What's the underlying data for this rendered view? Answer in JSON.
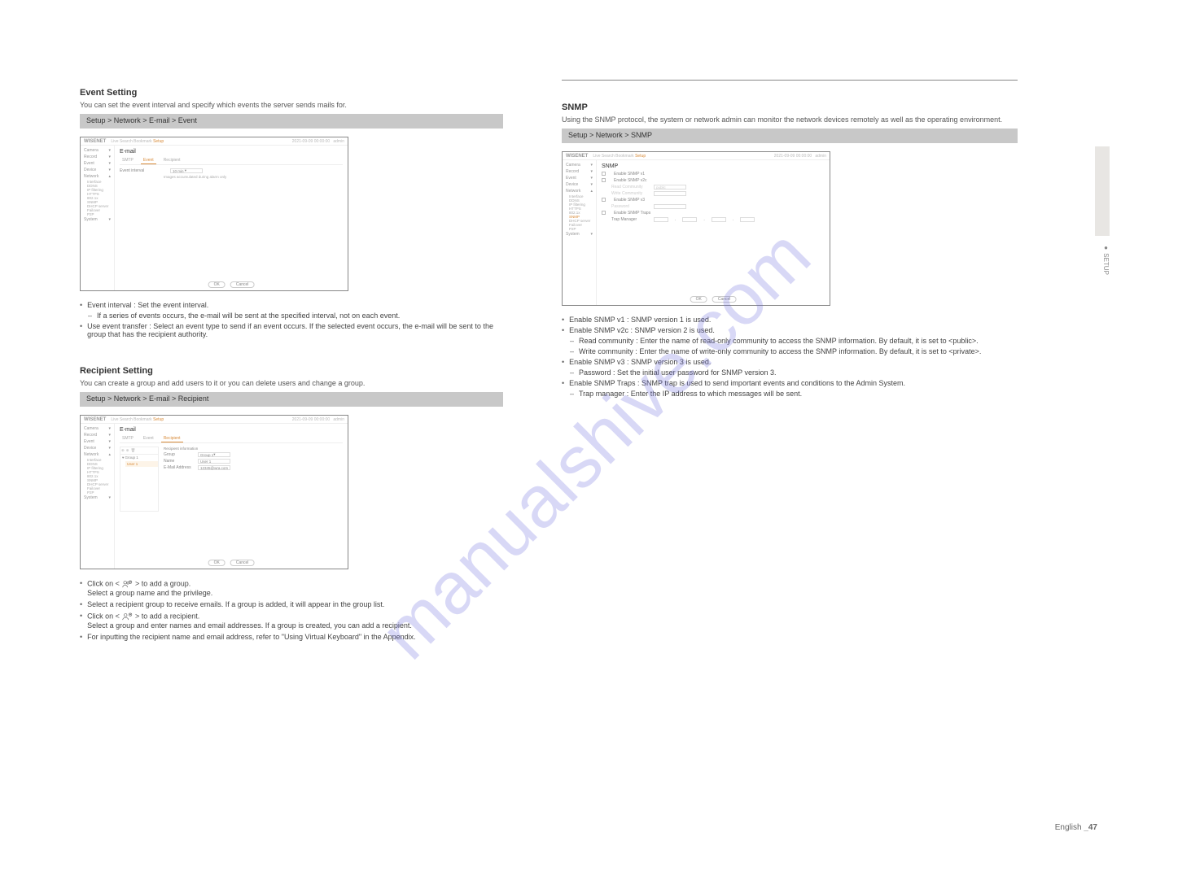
{
  "page": {
    "footer_label": "English",
    "footer_page": "_47"
  },
  "side_tab": {
    "label": "SETUP"
  },
  "watermark": "manualshive.com",
  "common_ui": {
    "logo": "WISENET",
    "topnav": {
      "live": "Live",
      "search": "Search",
      "bookmark": "Bookmark",
      "setup": "Setup"
    },
    "datetime": "2021-09-09 00:00:00",
    "user": "admin",
    "sidebar": {
      "camera": "Camera",
      "record": "Record",
      "event": "Event",
      "device": "Device",
      "network": "Network",
      "system": "System",
      "net_items": [
        "Interface",
        "DDNS",
        "IP filtering",
        "HTTPS",
        "802.1x",
        "SNMP",
        "DHCP server",
        "Failover",
        "P2P"
      ]
    },
    "buttons": {
      "ok": "OK",
      "cancel": "Cancel"
    }
  },
  "section_event": {
    "heading": "Event Setting",
    "desc": "You can set the event interval and specify which events the server sends mails for.",
    "bar": "Setup > Network > E-mail > Event",
    "screenshot": {
      "title": "E-mail",
      "tabs": {
        "smtp": "SMTP",
        "event": "Event",
        "recipient": "Recipient"
      },
      "field_label": "Event interval",
      "field_value": "10 min",
      "help": "Images accumulated during alarm only"
    },
    "bullets": [
      {
        "label": "Event interval",
        "text": ": Set the event interval."
      },
      {
        "sub": true,
        "text": "If a series of events occurs, the e-mail will be sent at the specified interval, not on each event."
      },
      {
        "label": "Use event transfer",
        "text": ": Select an event type to send if an event occurs. If the selected event occurs, the e-mail will be sent to the group that has the recipient authority."
      }
    ]
  },
  "section_recipient": {
    "heading": "Recipient Setting",
    "desc": "You can create a group and add users to it or you can delete users and change a group.",
    "bar": "Setup > Network > E-mail > Recipient",
    "screenshot": {
      "title": "E-mail",
      "tabs": {
        "smtp": "SMTP",
        "event": "Event",
        "recipient": "Recipient"
      },
      "group_toggle": "Group 1",
      "group_user": "User 1",
      "info_heading": "Recipient information",
      "field_group": "Group",
      "field_group_val": "Group 1",
      "field_name": "Name",
      "field_name_val": "User 1",
      "field_email": "E-Mail Address",
      "field_email_val": "12345@wra.com"
    },
    "bullets": [
      {
        "add_group": true,
        "text_before": "Click on <",
        "text_after": "> to add a group.",
        "text_tail": "Select a group name and the privilege."
      },
      {
        "text": "Select a recipient group to receive emails. If a group is added, it will appear in the group list."
      },
      {
        "add_recipient": true,
        "text_before": "Click on <",
        "text_after": "> to add a recipient.",
        "text_tail": "Select a group and enter names and email addresses. If a group is created, you can add a recipient."
      },
      {
        "text": "For inputting the recipient name and email address, refer to \"Using Virtual Keyboard\" in the Appendix."
      }
    ]
  },
  "section_snmp": {
    "heading": "SNMP",
    "desc": "Using the SNMP protocol, the system or network admin can monitor the network devices remotely as well as the operating environment.",
    "bar": "Setup > Network > SNMP",
    "screenshot": {
      "title": "SNMP",
      "v1": "Enable SNMP v1",
      "v2c": "Enable SNMP v2c",
      "readcomm": "Read Community",
      "readcomm_val": "public",
      "writecomm": "Write Community",
      "v3": "Enable SNMP v3",
      "password": "Password",
      "traps": "Enable SNMP Traps",
      "trapmgr": "Trap Manager"
    },
    "bullets": [
      {
        "label": "Enable SNMP v1",
        "text": ": SNMP version 1 is used."
      },
      {
        "label": "Enable SNMP v2c",
        "text": ": SNMP version 2 is used."
      },
      {
        "sub_label": "Read community",
        "text": ": Enter the name of read-only community to access the SNMP information. By default, it is set to <public>."
      },
      {
        "sub_label": "Write community",
        "text": ": Enter the name of write-only community to access the SNMP information. By default, it is set to <private>."
      },
      {
        "label": "Enable SNMP v3",
        "text": ": SNMP version 3 is used."
      },
      {
        "sub_label": "Password",
        "text": ": Set the initial user password for SNMP version 3."
      },
      {
        "label": "Enable SNMP Traps",
        "text": ": SNMP trap is used to send important events and conditions to the Admin System."
      },
      {
        "sub_label": "Trap manager",
        "text": ": Enter the IP address to which messages will be sent."
      }
    ]
  }
}
